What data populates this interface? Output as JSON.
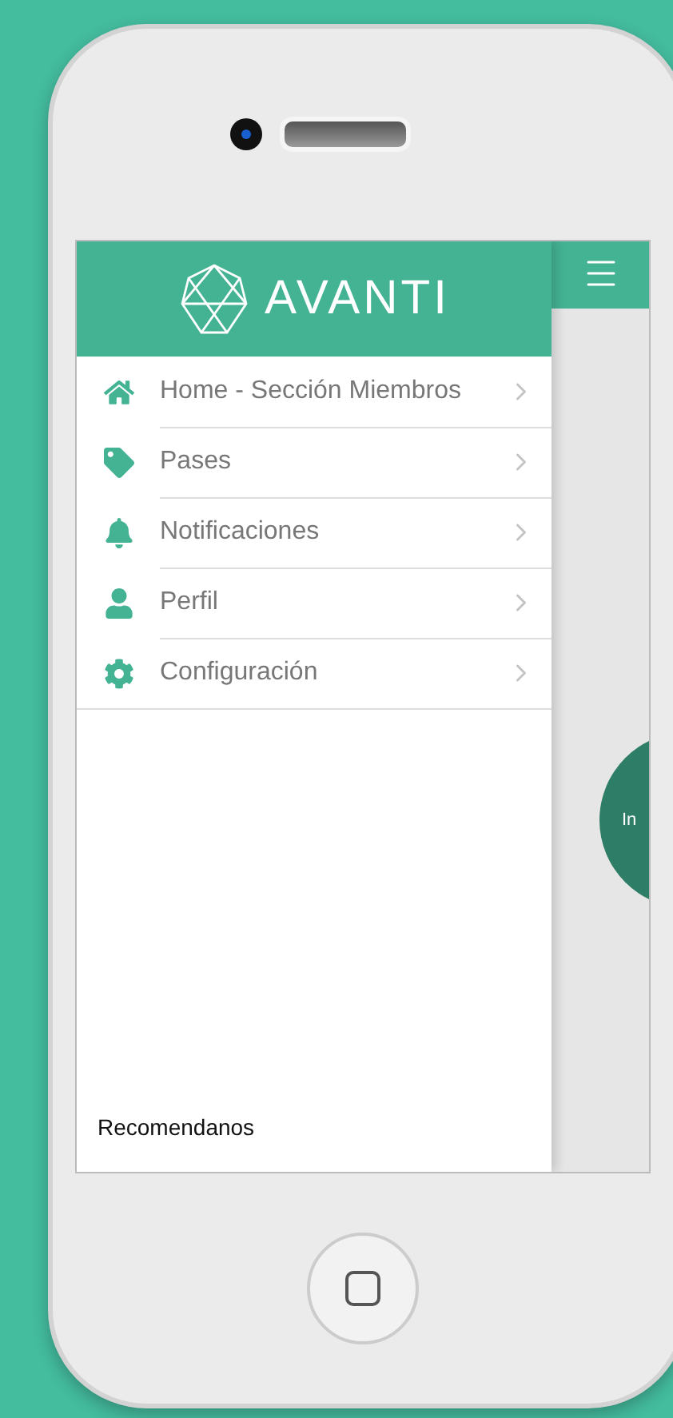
{
  "drawer": {
    "logo_text": "AVANTI",
    "menu": [
      {
        "label": "Home - Sección Miembros",
        "kind": "home"
      },
      {
        "label": "Pases",
        "kind": "tag"
      },
      {
        "label": "Notificaciones",
        "kind": "bell"
      },
      {
        "label": "Perfil",
        "kind": "user"
      },
      {
        "label": "Configuración",
        "kind": "gear"
      }
    ],
    "footer_link": "Recomendanos"
  },
  "main": {
    "circle_text": "In"
  }
}
